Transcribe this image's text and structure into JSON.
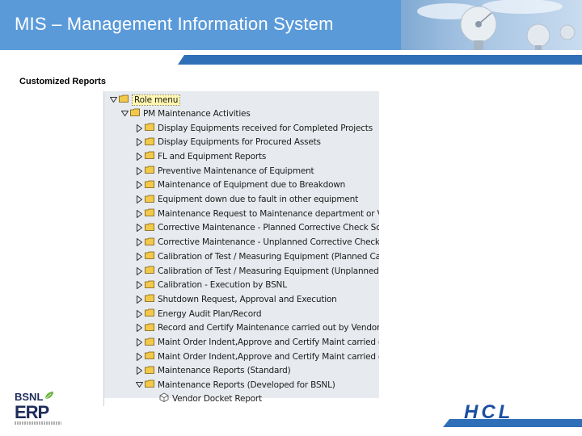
{
  "header": {
    "title": "MIS – Management Information System"
  },
  "section": {
    "title": "Customized Reports"
  },
  "tree": {
    "root": "Role menu",
    "group": "PM Maintenance Activities",
    "items": [
      "Display Equipments received for Completed Projects",
      "Display Equipments for Procured Assets",
      "FL and Equipment Reports",
      "Preventive Maintenance of Equipment",
      "Maintenance of Equipment due to Breakdown",
      "Equipment down due to fault in other equipment",
      "Maintenance Request to Maintenance department or Vendor",
      "Corrective Maintenance - Planned Corrective Check Schedule",
      "Corrective Maintenance - Unplanned Corrective Checks",
      "Calibration of Test / Measuring Equipment (Planned Calibration)",
      "Calibration of Test / Measuring Equipment (Unplanned Calibration)",
      "Calibration - Execution by BSNL",
      "Shutdown Request, Approval and Execution",
      "Energy Audit Plan/Record",
      "Record and Certify Maintenance carried out by Vendor",
      "Maint Order Indent,Approve and Certify Maint carried out by Vendor",
      "Maint Order Indent,Approve and Certify Maint carried out by Vendor",
      "Maintenance Reports (Standard)"
    ],
    "expanded_item": "Maintenance Reports (Developed for BSNL)",
    "leaf": "Vendor Docket Report"
  },
  "logos": {
    "bsnl": "BSNL",
    "erp": "ERP",
    "hcl": "HCL"
  },
  "colors": {
    "header_bg": "#5b9ad9",
    "accent_bar": "#2f6fb8",
    "panel_bg": "#e7ebef",
    "folder": "#f3c94a"
  }
}
